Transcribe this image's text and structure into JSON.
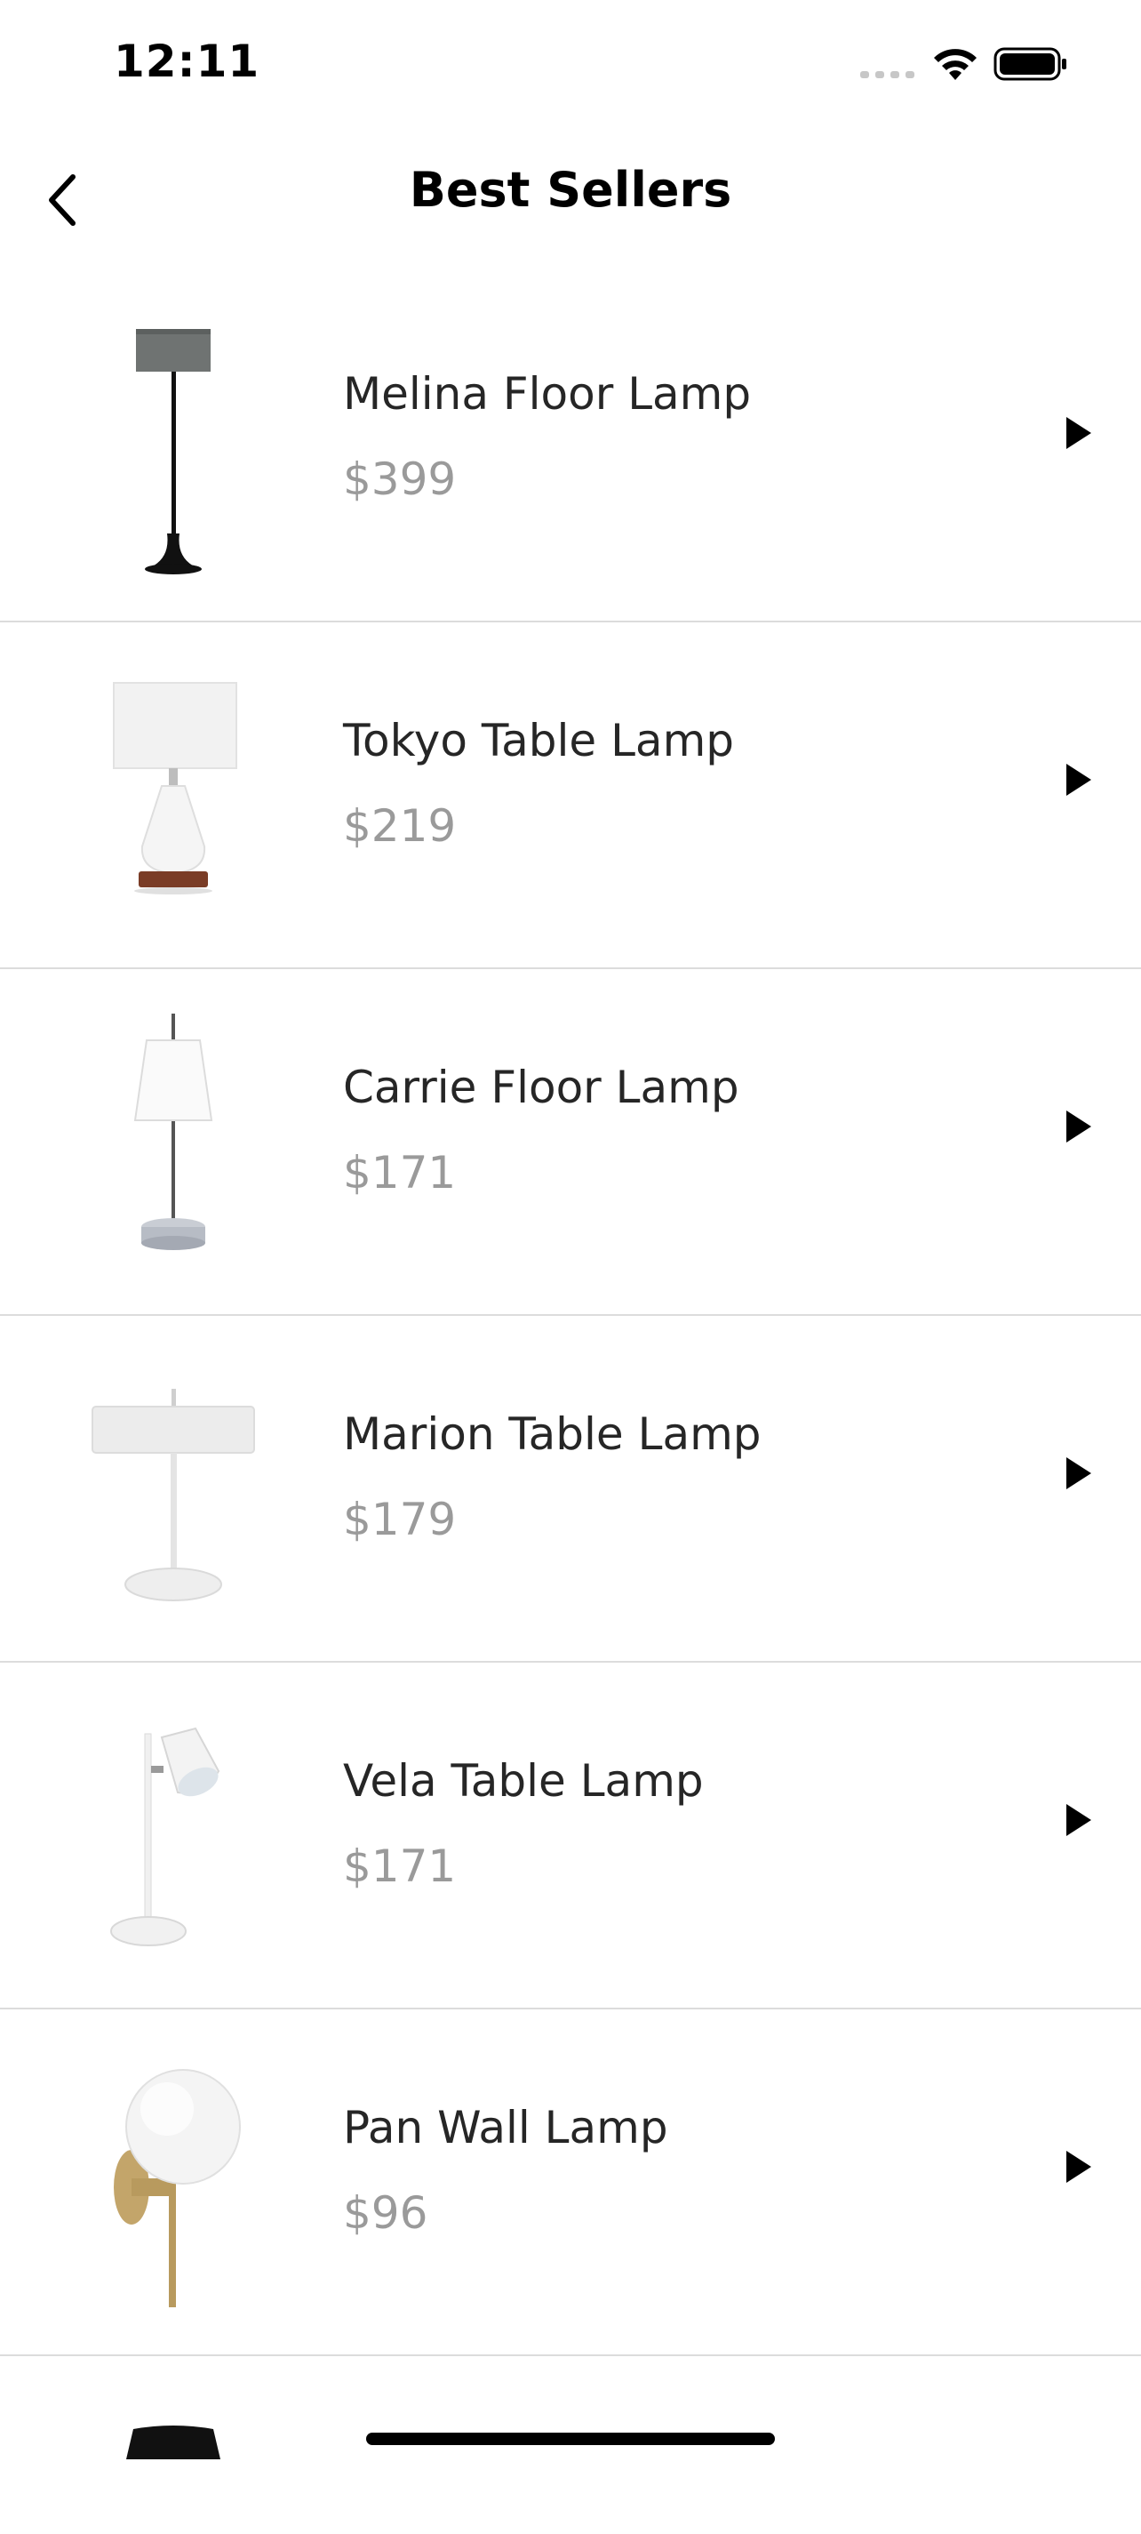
{
  "status_bar": {
    "time": "12:11"
  },
  "nav": {
    "title": "Best Sellers",
    "back_icon": "chevron-left-icon"
  },
  "products": [
    {
      "name": "Melina Floor Lamp",
      "price": "$399",
      "icon": "floor-lamp-thumbnail"
    },
    {
      "name": "Tokyo Table Lamp",
      "price": "$219",
      "icon": "table-lamp-thumbnail"
    },
    {
      "name": "Carrie Floor Lamp",
      "price": "$171",
      "icon": "floor-lamp-thumbnail"
    },
    {
      "name": "Marion Table Lamp",
      "price": "$179",
      "icon": "table-lamp-thumbnail"
    },
    {
      "name": "Vela Table Lamp",
      "price": "$171",
      "icon": "table-lamp-thumbnail"
    },
    {
      "name": "Pan Wall Lamp",
      "price": "$96",
      "icon": "wall-lamp-thumbnail"
    }
  ],
  "colors": {
    "text_primary": "#262626",
    "text_price": "#9a9a9a",
    "divider": "#dcdcdc",
    "lamp_brass": "#b89a5e"
  }
}
